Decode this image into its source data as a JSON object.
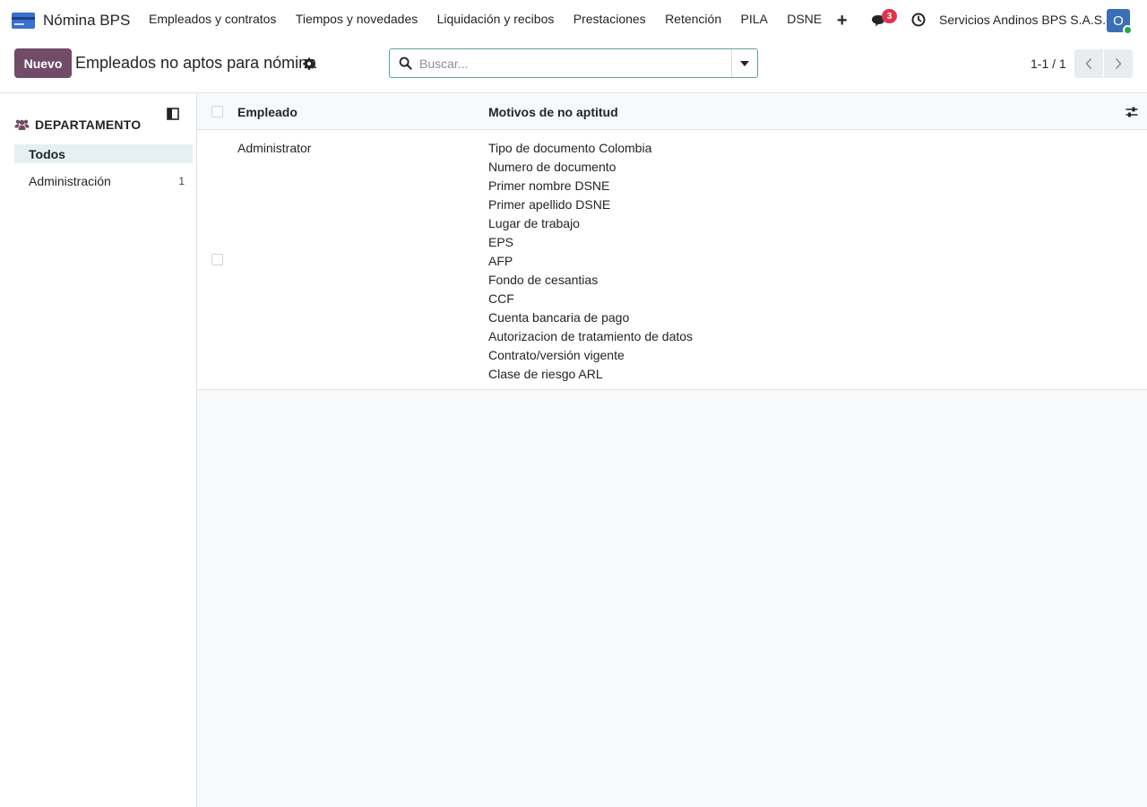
{
  "navbar": {
    "app_name": "Nómina BPS",
    "menu": [
      "Empleados y contratos",
      "Tiempos y novedades",
      "Liquidación y recibos",
      "Prestaciones",
      "Retención",
      "PILA",
      "DSNE"
    ],
    "plus_label": "+",
    "messages_badge": "3",
    "company": "Servicios Andinos BPS S.A.S.",
    "avatar_initial": "O"
  },
  "control": {
    "new_label": "Nuevo",
    "title": "Empleados no aptos para nómina",
    "search_placeholder": "Buscar...",
    "pager": "1-1 / 1"
  },
  "sidebar": {
    "title": "DEPARTAMENTO",
    "items": [
      {
        "label": "Todos",
        "count": ""
      },
      {
        "label": "Administración",
        "count": "1"
      }
    ]
  },
  "list": {
    "columns": [
      "Empleado",
      "Motivos de no aptitud"
    ],
    "rows": [
      {
        "employee": "Administrator",
        "reasons": [
          "Tipo de documento Colombia",
          "Numero de documento",
          "Primer nombre DSNE",
          "Primer apellido DSNE",
          "Lugar de trabajo",
          "EPS",
          "AFP",
          "Fondo de cesantias",
          "CCF",
          "Cuenta bancaria de pago",
          "Autorizacion de tratamiento de datos",
          "Contrato/versión vigente",
          "Clase de riesgo ARL"
        ]
      }
    ]
  },
  "colors": {
    "brand": "#714b67",
    "badge": "#e3324a",
    "avatar": "#3a6fb5",
    "online": "#28a745",
    "active_filter": "#e6f0f2"
  },
  "icons": [
    "app-logo-icon",
    "chat-icon",
    "clock-icon",
    "gear-icon",
    "search-icon",
    "caret-down-icon",
    "chevron-left-icon",
    "chevron-right-icon",
    "users-icon",
    "panel-collapse-icon",
    "sliders-icon"
  ]
}
